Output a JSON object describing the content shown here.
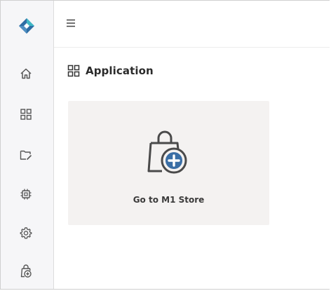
{
  "page": {
    "title": "Application"
  },
  "sidebar": {
    "items": [
      {
        "name": "home",
        "icon": "home-icon"
      },
      {
        "name": "applications",
        "icon": "grid-icon"
      },
      {
        "name": "files",
        "icon": "folder-edit-icon"
      },
      {
        "name": "devices",
        "icon": "chip-icon"
      },
      {
        "name": "settings",
        "icon": "gear-icon"
      },
      {
        "name": "store",
        "icon": "shopping-bag-plus-icon"
      }
    ]
  },
  "store_card": {
    "label": "Go to M1 Store",
    "icon": "shopping-bag-plus-icon"
  },
  "colors": {
    "logo_blue": "#2e6da4",
    "logo_teal": "#3fb7c5",
    "icon_gray": "#555555",
    "card_bg": "#f4f2f1",
    "accent_blue": "#3a6ea5"
  }
}
